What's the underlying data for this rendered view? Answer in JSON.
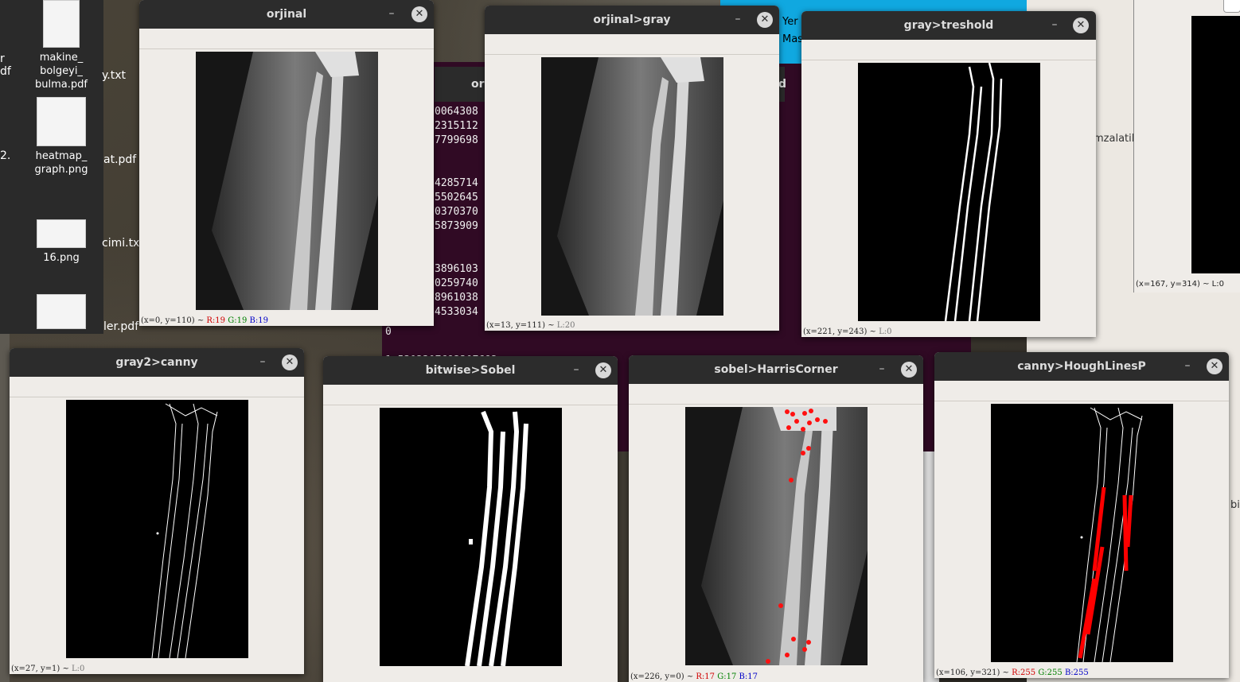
{
  "desktop": {
    "icons": [
      {
        "label": "makine_\nbolgeyi_\nbulma.pdf"
      },
      {
        "label": "heatmap_\ngraph.png"
      },
      {
        "label": "16.png"
      }
    ],
    "partial_labels": [
      "r",
      "df",
      "2.",
      "y.txt",
      "at.pdf",
      "cimi.txt",
      "ler.pdf"
    ]
  },
  "terminal": {
    "header_left": "or",
    "header_right": "d",
    "lines": [
      "0064308",
      "2315112",
      "7799698",
      "",
      "",
      "4285714",
      "5502645",
      "0370370",
      "5873909",
      "",
      "",
      "3896103",
      "0259740",
      "8961038",
      "4533034"
    ],
    "bottom_lines": [
      "0",
      "1.5302307692307692"
    ]
  },
  "background_texts": {
    "blue_line1": "Yer",
    "blue_line2": "Mas",
    "right_text": "mzalatil",
    "right_status": "(x=167, y=314) ~ L:0",
    "bi_text": "bi"
  },
  "windows": [
    {
      "title": "orjinal",
      "status_pos": "(x=0, y=110) ~ ",
      "r": "R:19",
      "g": "G:19",
      "b": "B:19",
      "l": ""
    },
    {
      "title": "orjinal>gray",
      "status_pos": "(x=13, y=111) ~ ",
      "r": "",
      "g": "",
      "b": "",
      "l": "L:20"
    },
    {
      "title": "gray>treshold",
      "status_pos": "(x=221, y=243) ~ ",
      "r": "",
      "g": "",
      "b": "",
      "l": "L:0"
    },
    {
      "title": "gray2>canny",
      "status_pos": "(x=27, y=1) ~ ",
      "r": "",
      "g": "",
      "b": "",
      "l": "L:0"
    },
    {
      "title": "bitwise>Sobel",
      "status_pos": "",
      "r": "",
      "g": "",
      "b": "",
      "l": ""
    },
    {
      "title": "sobel>HarrisCorner",
      "status_pos": "(x=226, y=0) ~ ",
      "r": "R:17",
      "g": "G:17",
      "b": "B:17",
      "l": ""
    },
    {
      "title": "canny>HoughLinesP",
      "status_pos": "(x=106, y=321) ~ ",
      "r": "R:255",
      "g": "G:255",
      "b": "B:255",
      "l": ""
    }
  ],
  "colors": {
    "titlebar": "#2c2c2c",
    "window_body": "#efece8",
    "terminal": "#300a24",
    "corner_marker": "#ff1010",
    "hough_line": "#ff0000"
  },
  "icons": {
    "minimize": "–",
    "close": "✕"
  }
}
